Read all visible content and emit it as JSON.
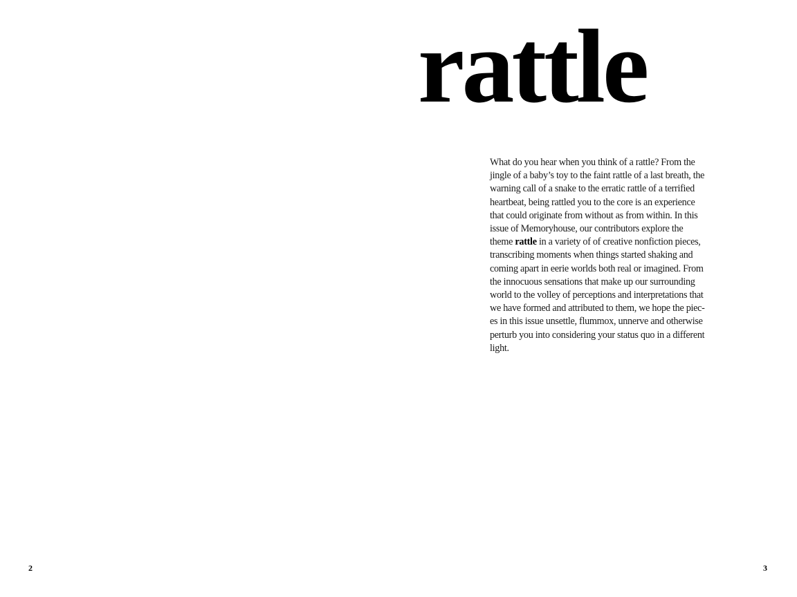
{
  "left_page": {
    "page_number": "2"
  },
  "right_page": {
    "title": "rattle",
    "page_number": "3",
    "intro": {
      "line_01": "What do you hear when you think of a rattle? From the",
      "line_02": "jingle of a baby’s toy to the faint rattle of a last breath, the",
      "line_03": "warning call of a snake to the erratic rattle of a terrified",
      "line_04": "heartbeat, being rattled you to the core is an experience",
      "line_05": "that could originate from without as from within. In this",
      "line_06": "issue of Memoryhouse, our contributors explore the",
      "line_07_before": "theme ",
      "line_07_bold": "rattle",
      "line_07_after": " in a variety of of creative nonfiction pieces,",
      "line_08": "transcribing  moments when things started shaking and",
      "line_09": "coming apart in eerie worlds both real or imagined. From",
      "line_10": "the innocuous sensations that make up our surrounding",
      "line_11": "world to the volley of perceptions and interpretations that",
      "line_12": "we have formed and attributed to them, we hope the piec-",
      "line_13": "es in this issue unsettle, flummox, unnerve and otherwise",
      "line_14": "perturb you into considering your status quo in a different",
      "line_15": "light."
    }
  }
}
